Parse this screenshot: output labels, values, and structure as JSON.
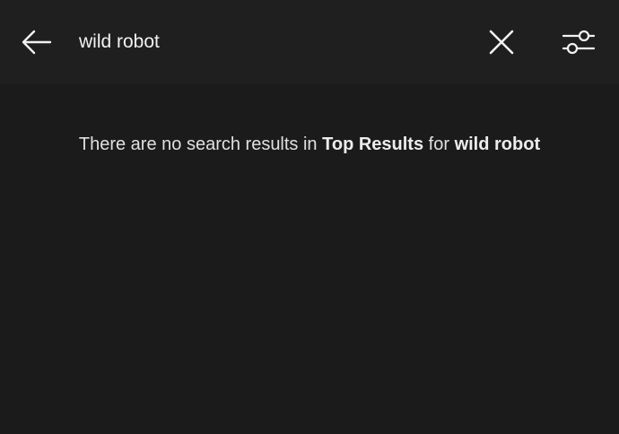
{
  "search": {
    "query": "wild robot"
  },
  "icons": {
    "back": "back-arrow-icon",
    "clear": "close-icon",
    "filter": "filter-sliders-icon"
  },
  "results": {
    "message_prefix": "There are no search results in",
    "tab_name": "Top Results",
    "message_middle": "for",
    "query_echo": "wild robot"
  },
  "colors": {
    "background": "#1b1b1b",
    "header": "#1f1f1f",
    "text": "#e0e0e0",
    "icon": "#f2f2f2"
  }
}
